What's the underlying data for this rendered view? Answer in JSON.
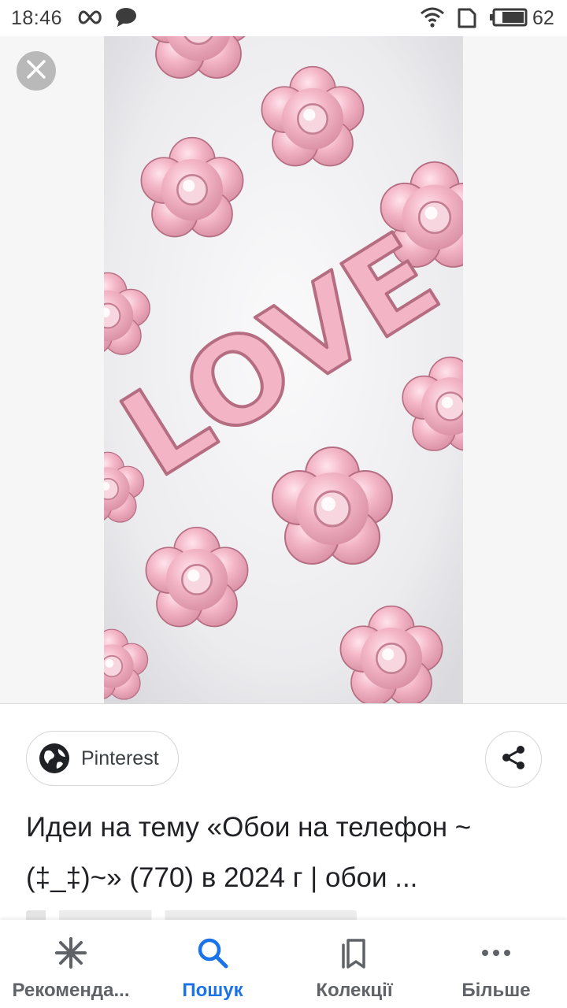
{
  "status_bar": {
    "time": "18:46",
    "battery_level": "62",
    "icons": [
      "infinity-icon",
      "chat-bubble-icon",
      "wifi-icon",
      "sim-card-icon",
      "battery-icon"
    ]
  },
  "viewer": {
    "close_icon": "close-icon",
    "image_text": "LOVE",
    "colors": {
      "pink": "#f2b6c6",
      "pink_dark": "#c97f93",
      "background": "#f1f1f3"
    }
  },
  "info": {
    "source_label": "Pinterest",
    "source_icon": "globe-icon",
    "share_icon": "share-icon",
    "title": "Идеи на тему «Обои на телефон ~(‡_‡)~» (770) в 2024 г | обои ..."
  },
  "bottom_nav": {
    "items": [
      {
        "label": "Рекоменда...",
        "icon": "asterisk-icon",
        "active": false
      },
      {
        "label": "Пошук",
        "icon": "search-icon",
        "active": true
      },
      {
        "label": "Колекції",
        "icon": "collections-icon",
        "active": false
      },
      {
        "label": "Більше",
        "icon": "more-icon",
        "active": false
      }
    ],
    "active_color": "#1a73e8",
    "inactive_color": "#5f6368"
  }
}
